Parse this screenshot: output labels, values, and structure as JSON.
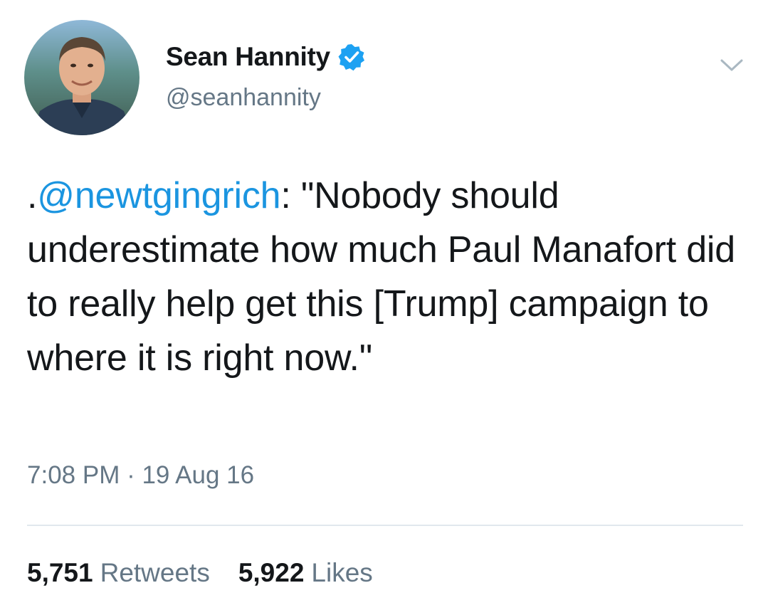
{
  "author": {
    "display_name": "Sean Hannity",
    "handle": "@seanhannity",
    "verified_icon": "verified-badge-icon",
    "avatar_icon": "profile-photo"
  },
  "tweet": {
    "text_prefix": ".",
    "mention": "@newtgingrich",
    "text_body": ": \"Nobody should underestimate how much Paul Manafort did to really help get this [Trump] campaign to where it is right now.\"",
    "timestamp": "7:08 PM · 19 Aug 16"
  },
  "stats": {
    "retweets_count": "5,751",
    "retweets_label": "Retweets",
    "likes_count": "5,922",
    "likes_label": "Likes"
  },
  "colors": {
    "mention_blue": "#1b95e0",
    "verified_blue": "#1da1f2",
    "secondary_gray": "#657786",
    "text_dark": "#14171a",
    "divider": "#e1e8ed"
  },
  "menu_icon": "chevron-down-icon"
}
